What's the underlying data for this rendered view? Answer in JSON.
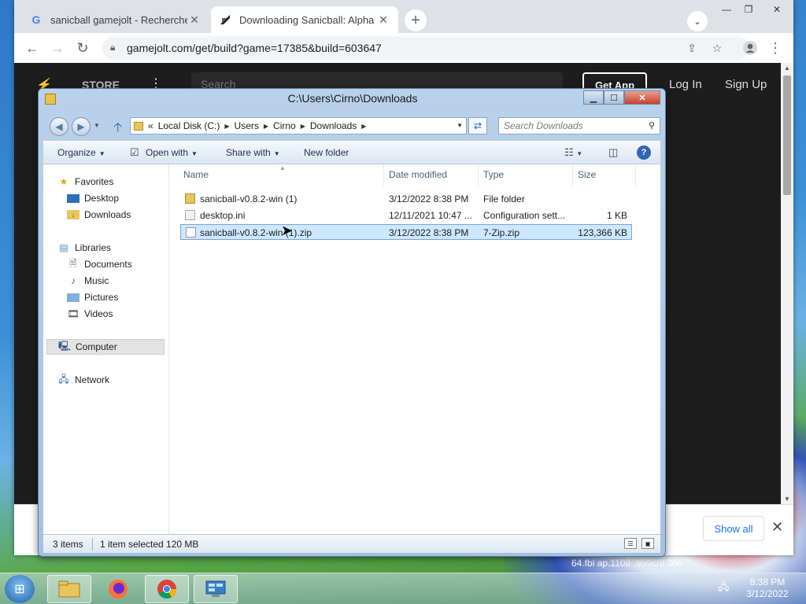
{
  "chrome": {
    "tabs": [
      {
        "title": "sanicball gamejolt - Recherche G",
        "icon": "google-g-icon",
        "close": "✕"
      },
      {
        "title": "Downloading Sanicball: Alpha (v",
        "icon": "gamejolt-icon",
        "close": "✕"
      }
    ],
    "new_tab": "+",
    "url": "gamejolt.com/get/build?game=17385&build=603647"
  },
  "gamejolt": {
    "store": "STORE",
    "search_placeholder": "Search",
    "get_app": "Get App",
    "log_in": "Log In",
    "sign_up": "Sign Up"
  },
  "downloads_bar": {
    "show_all": "Show all",
    "close": "✕"
  },
  "explorer": {
    "title": "C:\\Users\\Cirno\\Downloads",
    "breadcrumb": [
      "«",
      "Local Disk (C:)",
      "Users",
      "Cirno",
      "Downloads"
    ],
    "search_placeholder": "Search Downloads",
    "commands": {
      "organize": "Organize",
      "open_with": "Open with",
      "share_with": "Share with",
      "new_folder": "New folder"
    },
    "nav": {
      "favorites": "Favorites",
      "desktop": "Desktop",
      "downloads": "Downloads",
      "libraries": "Libraries",
      "documents": "Documents",
      "music": "Music",
      "pictures": "Pictures",
      "videos": "Videos",
      "computer": "Computer",
      "network": "Network"
    },
    "columns": {
      "name": "Name",
      "date": "Date modified",
      "type": "Type",
      "size": "Size"
    },
    "files": [
      {
        "name": "sanicball-v0.8.2-win (1)",
        "date": "3/12/2022 8:38 PM",
        "type": "File folder",
        "size": ""
      },
      {
        "name": "desktop.ini",
        "date": "12/11/2021 10:47 ...",
        "type": "Configuration sett...",
        "size": "1 KB"
      },
      {
        "name": "sanicball-v0.8.2-win (1).zip",
        "date": "3/12/2022 8:38 PM",
        "type": "7-Zip.zip",
        "size": "123,366 KB"
      }
    ],
    "status": {
      "count": "3 items",
      "selection": "1 item selected  120 MB"
    }
  },
  "taskbar": {
    "time": "8:38 PM",
    "date": "3/12/2022"
  },
  "desktop_text": "64.fbl    ap.1108    .959cf9    36o"
}
